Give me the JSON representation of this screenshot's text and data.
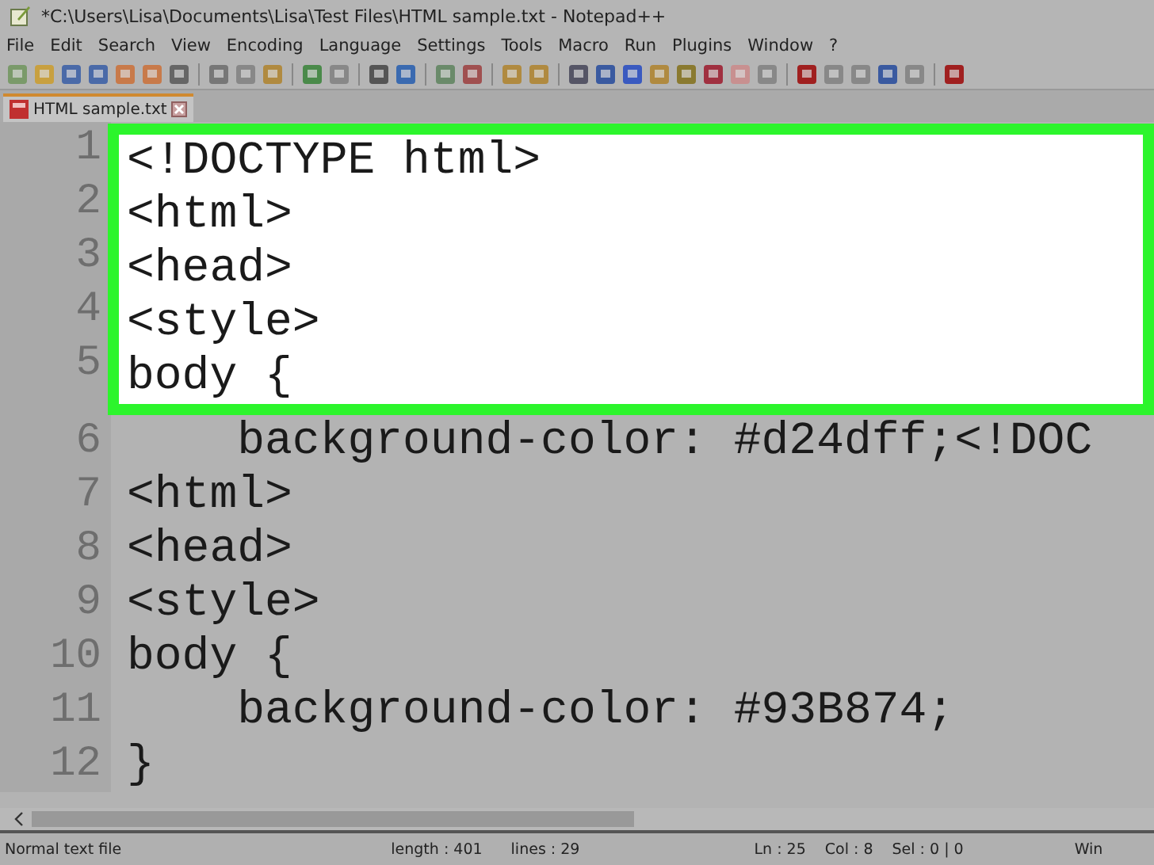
{
  "window": {
    "title": "*C:\\Users\\Lisa\\Documents\\Lisa\\Test Files\\HTML sample.txt - Notepad++"
  },
  "menu": [
    "File",
    "Edit",
    "Search",
    "View",
    "Encoding",
    "Language",
    "Settings",
    "Tools",
    "Macro",
    "Run",
    "Plugins",
    "Window",
    "?"
  ],
  "tabs": [
    {
      "label": "HTML sample.txt",
      "selected": true
    }
  ],
  "editor": {
    "sections": [
      {
        "highlighted": true,
        "lines": [
          {
            "number": "1",
            "code": "<!DOCTYPE html>"
          },
          {
            "number": "2",
            "code": "<html>"
          },
          {
            "number": "3",
            "code": "<head>"
          },
          {
            "number": "4",
            "code": "<style>"
          },
          {
            "number": "5",
            "code": "body {"
          }
        ]
      },
      {
        "highlighted": false,
        "lines": [
          {
            "number": "6",
            "code": "    background-color: #d24dff;<!DOC"
          },
          {
            "number": "7",
            "code": "<html>"
          },
          {
            "number": "8",
            "code": "<head>"
          },
          {
            "number": "9",
            "code": "<style>"
          },
          {
            "number": "10",
            "code": "body {"
          },
          {
            "number": "11",
            "code": "    background-color: #93B874;"
          },
          {
            "number": "12",
            "code": "}"
          }
        ]
      }
    ]
  },
  "status_bar": [
    "Normal text file",
    "length : 401",
    "lines : 29",
    "Ln : 25",
    "Col : 8",
    "Sel : 0 | 0",
    "Win"
  ]
}
